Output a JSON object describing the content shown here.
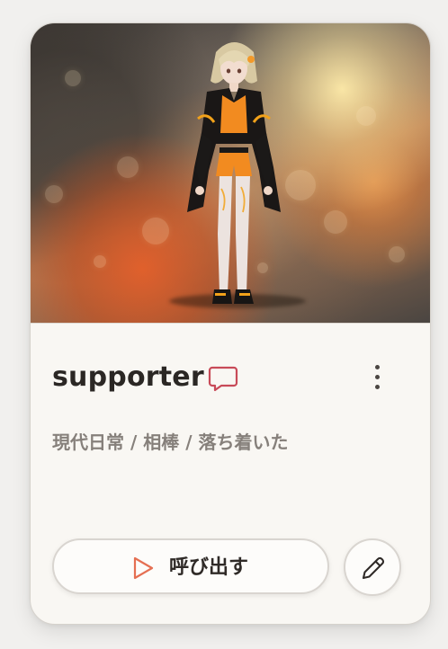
{
  "card": {
    "name": "supporter",
    "tags": "現代日常 / 相棒 / 落ち着いた",
    "call_label": "呼び出す",
    "icons": {
      "chat": "chat-bubble-icon",
      "more": "more-vertical-icon",
      "play": "play-icon",
      "edit": "pencil-icon"
    }
  },
  "colors": {
    "accent": "#e56f52",
    "chat_icon": "#c84a58",
    "title_text": "#2b2724",
    "tag_text": "#86807b",
    "button_border": "#d9d5d0"
  }
}
